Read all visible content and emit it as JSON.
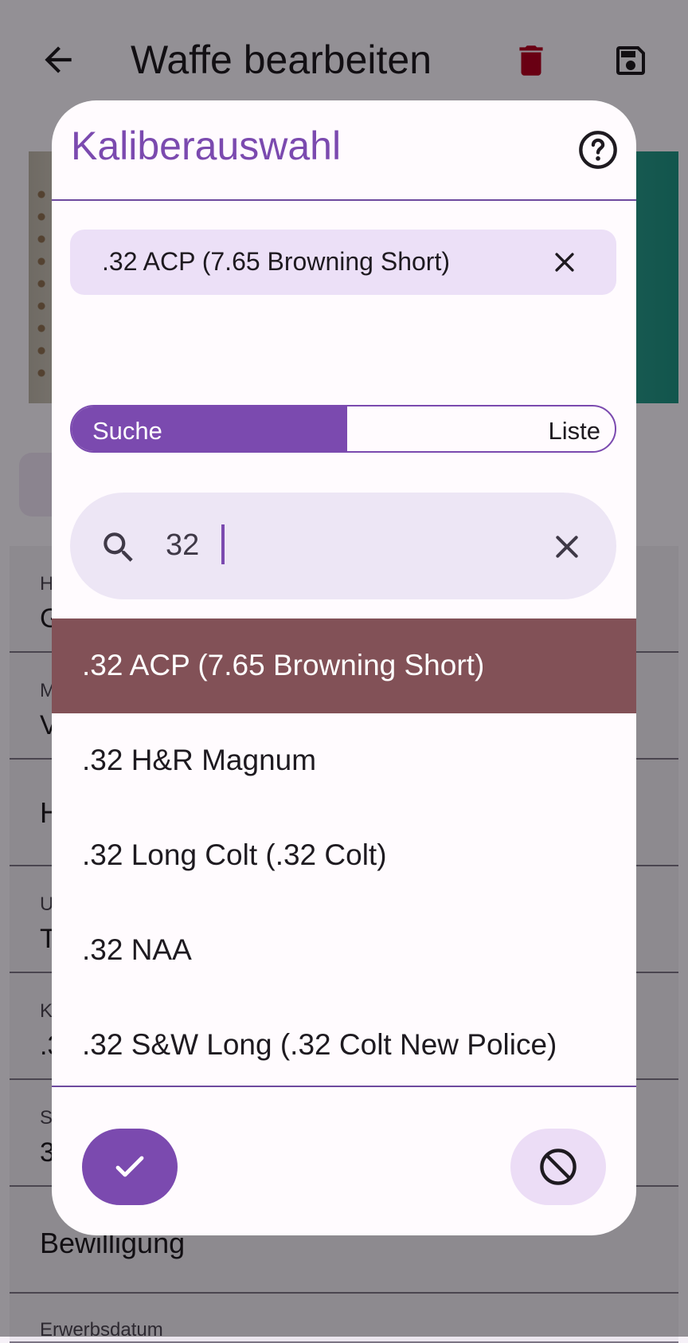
{
  "appbar": {
    "title": "Waffe bearbeiten",
    "icons": [
      "back-arrow-icon",
      "trash-icon",
      "save-icon"
    ],
    "trash_color": "#b00020"
  },
  "background_fields": [
    {
      "label": "H",
      "value": "G"
    },
    {
      "label": "M",
      "value": "V"
    },
    {
      "label": "",
      "value": "H"
    },
    {
      "label": "U",
      "value": "T"
    },
    {
      "label": "K",
      "value": ".3"
    },
    {
      "label": "S",
      "value": "3"
    },
    {
      "label": "",
      "value": "Bewilligung"
    },
    {
      "label": "Erwerbsdatum",
      "value": ""
    }
  ],
  "dialog": {
    "title": "Kaliberauswahl",
    "selected_chip": ".32 ACP (7.65 Browning Short)",
    "segment": {
      "search_label": "Suche",
      "list_label": "Liste",
      "active": "Suche"
    },
    "search": {
      "value": "32"
    },
    "results": [
      ".32 ACP (7.65 Browning Short)",
      ".32 H&R Magnum",
      ".32 Long Colt (.32 Colt)",
      ".32 NAA",
      ".32 S&W Long (.32 Colt New Police)"
    ],
    "highlighted_index": 0,
    "colors": {
      "accent": "#7b4aaf",
      "highlight": "#825157",
      "chip": "#ece0f7"
    },
    "actions": [
      "check-icon",
      "block-icon"
    ]
  }
}
